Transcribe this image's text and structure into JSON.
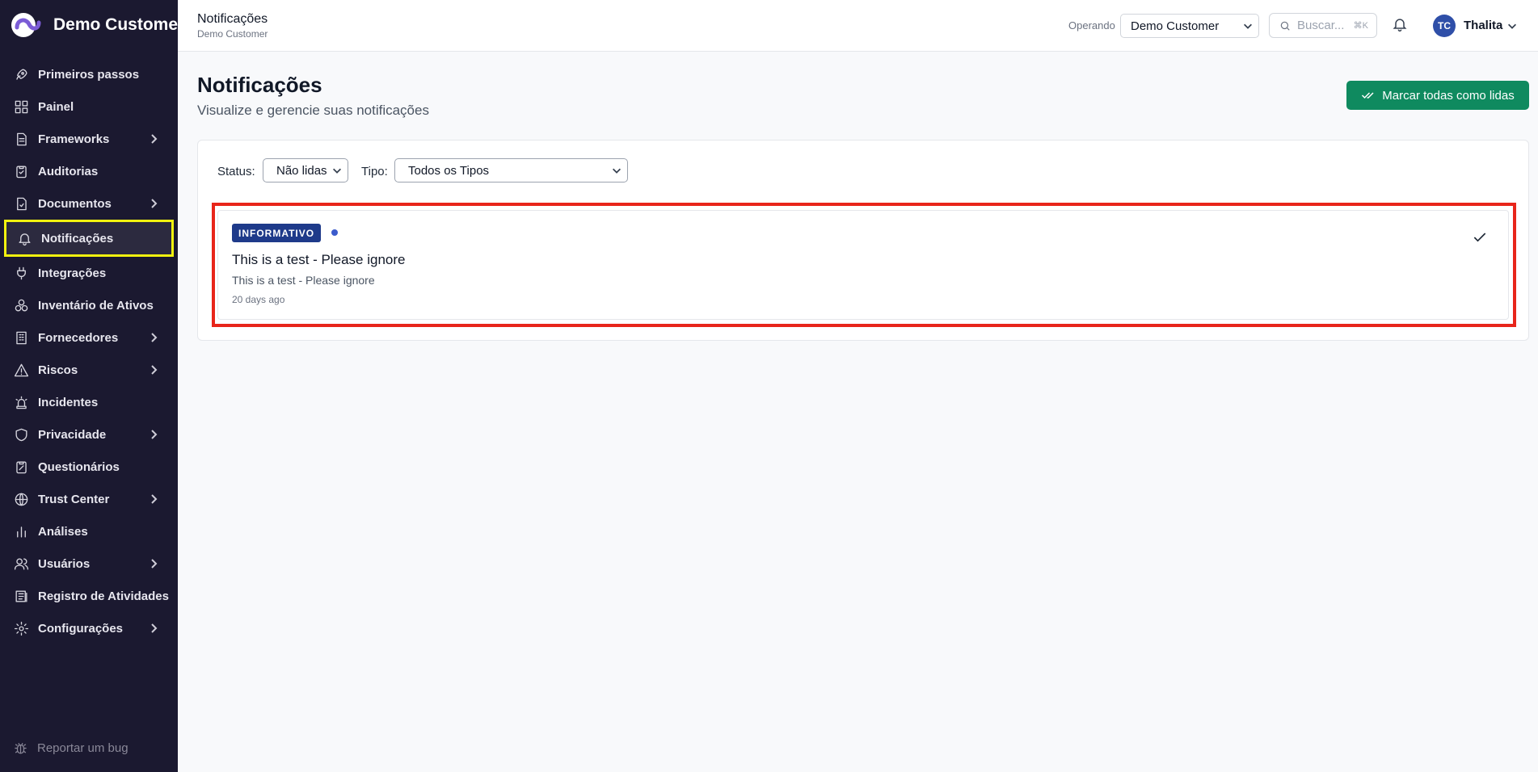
{
  "sidebar": {
    "brand": "Demo Customer",
    "items": [
      {
        "label": "Primeiros passos",
        "icon": "rocket-icon"
      },
      {
        "label": "Painel",
        "icon": "dashboard-icon"
      },
      {
        "label": "Frameworks",
        "icon": "document-icon",
        "has_children": true
      },
      {
        "label": "Auditorias",
        "icon": "clipboard-check-icon"
      },
      {
        "label": "Documentos",
        "icon": "file-icon",
        "has_children": true
      },
      {
        "label": "Notificações",
        "icon": "bell-icon",
        "active": true
      },
      {
        "label": "Integrações",
        "icon": "plug-icon"
      },
      {
        "label": "Inventário de Ativos",
        "icon": "boxes-icon"
      },
      {
        "label": "Fornecedores",
        "icon": "building-icon",
        "has_children": true
      },
      {
        "label": "Riscos",
        "icon": "warning-icon",
        "has_children": true
      },
      {
        "label": "Incidentes",
        "icon": "siren-icon"
      },
      {
        "label": "Privacidade",
        "icon": "shield-icon",
        "has_children": true
      },
      {
        "label": "Questionários",
        "icon": "questionnaire-icon"
      },
      {
        "label": "Trust Center",
        "icon": "globe-icon",
        "has_children": true
      },
      {
        "label": "Análises",
        "icon": "bar-chart-icon"
      },
      {
        "label": "Usuários",
        "icon": "users-icon",
        "has_children": true
      },
      {
        "label": "Registro de Atividades",
        "icon": "log-icon"
      },
      {
        "label": "Configurações",
        "icon": "gear-icon",
        "has_children": true
      }
    ],
    "report_bug": "Reportar um bug"
  },
  "header": {
    "title": "Notificações",
    "subtitle": "Demo Customer",
    "operando_label": "Operando",
    "customer_select": "Demo Customer",
    "search_placeholder": "Buscar...",
    "search_shortcut": "⌘K",
    "user_initials": "TC",
    "user_name": "Thalita"
  },
  "main": {
    "title": "Notificações",
    "subtitle": "Visualize e gerencie suas notificações",
    "mark_all_label": "Marcar todas como lidas",
    "filters": {
      "status_label": "Status:",
      "status_value": "Não lidas",
      "tipo_label": "Tipo:",
      "tipo_value": "Todos os Tipos"
    },
    "notifications": [
      {
        "badge": "INFORMATIVO",
        "title": "This is a test - Please ignore",
        "message": "This is a test - Please ignore",
        "time": "20 days ago",
        "unread": true
      }
    ]
  },
  "colors": {
    "sidebar_bg": "#1b1930",
    "accent_green": "#0f8a5f",
    "badge_blue": "#1e3a8a",
    "active_highlight": "#f2f20f",
    "card_highlight": "#e8251a"
  }
}
